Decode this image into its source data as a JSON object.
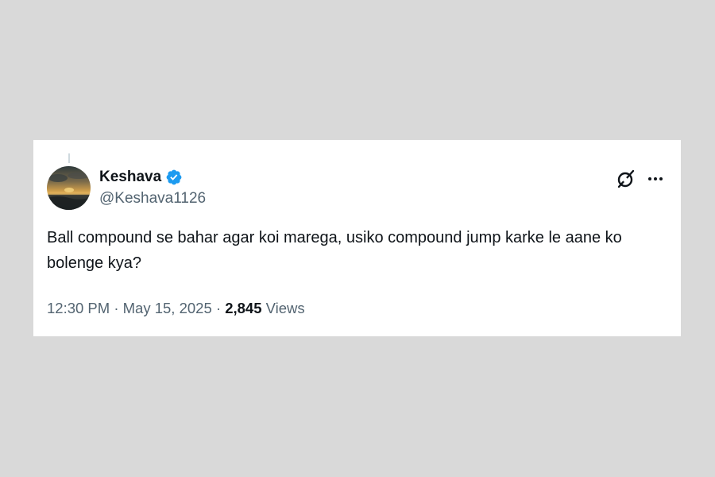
{
  "tweet": {
    "author": {
      "display_name": "Keshava",
      "handle": "@Keshava1126",
      "verified": true,
      "avatar": "sunset-sea-photo"
    },
    "text": "Ball compound se bahar agar koi marega, usiko compound jump karke le aane ko bolenge kya?",
    "time": "12:30 PM",
    "separator": "·",
    "date": "May 15, 2025",
    "views_count": "2,845",
    "views_label": "Views",
    "icons": {
      "verified": "verified-badge-icon",
      "grok": "grok-icon",
      "more": "more-options-icon"
    }
  },
  "colors": {
    "background": "#d9d9d9",
    "card": "#ffffff",
    "text_primary": "#0f1419",
    "text_secondary": "#536471",
    "verified_blue": "#1d9bf0"
  }
}
